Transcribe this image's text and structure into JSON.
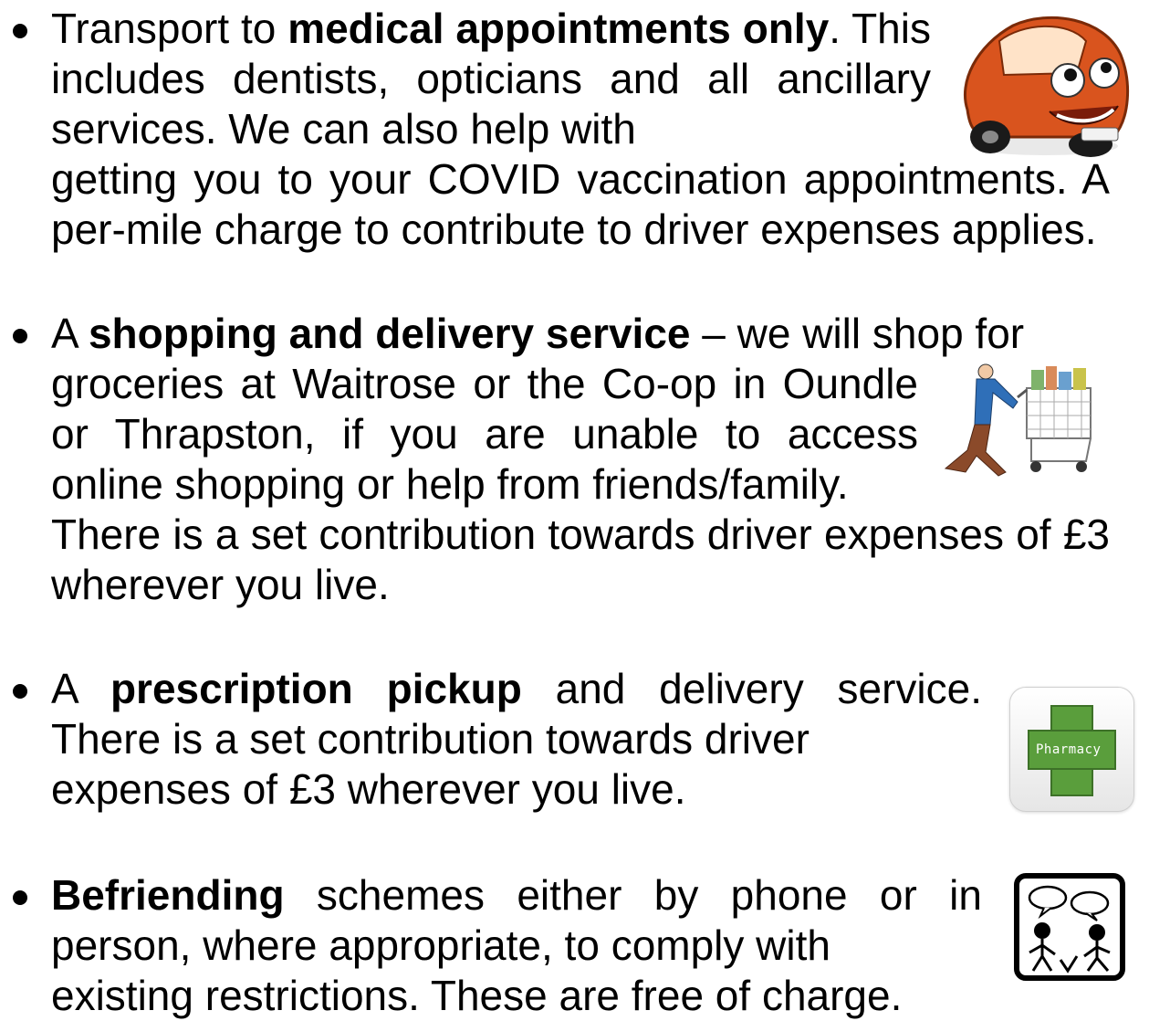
{
  "items": [
    {
      "wrap_segments": [
        {
          "text": "Transport to ",
          "bold": false
        },
        {
          "text": "medical appointments only",
          "bold": true
        },
        {
          "text": ". This includes dentists, opticians and all ancillary services. We can also help with",
          "bold": false
        }
      ],
      "full_text": "getting you to your COVID vaccination appointments. A per-mile charge to contribute to driver expenses applies.",
      "icon": "smiling-car-icon"
    },
    {
      "lead_segments": [
        {
          "text": "A ",
          "bold": false
        },
        {
          "text": "shopping and delivery service",
          "bold": true
        },
        {
          "text": " – we will shop for",
          "bold": false
        }
      ],
      "wrap_text": "groceries at Waitrose or the Co-op in Oundle or Thrapston, if you are unable to access online shopping or help from friends/family.",
      "full_text": "There is a set contribution towards driver expenses of £3 wherever you live.",
      "icon": "shopping-trolley-icon"
    },
    {
      "wrap_segments": [
        {
          "text": "A ",
          "bold": false
        },
        {
          "text": "prescription pickup",
          "bold": true
        },
        {
          "text": " and delivery service. There is a set contribution towards driver",
          "bold": false
        }
      ],
      "full_text": "expenses of £3 wherever you live.",
      "icon": "pharmacy-cross-icon",
      "icon_label": "Pharmacy"
    },
    {
      "wrap_segments": [
        {
          "text": "Befriending",
          "bold": true
        },
        {
          "text": " schemes either by phone or in person, where appropriate, to comply with",
          "bold": false
        }
      ],
      "full_text": "existing restrictions. These are free of charge.",
      "icon": "befriending-people-icon"
    }
  ],
  "colors": {
    "text": "#000000",
    "car_body": "#d9541e",
    "pharmacy_green": "#5a9e3c",
    "trolley_person_shirt": "#2f6fb8"
  }
}
